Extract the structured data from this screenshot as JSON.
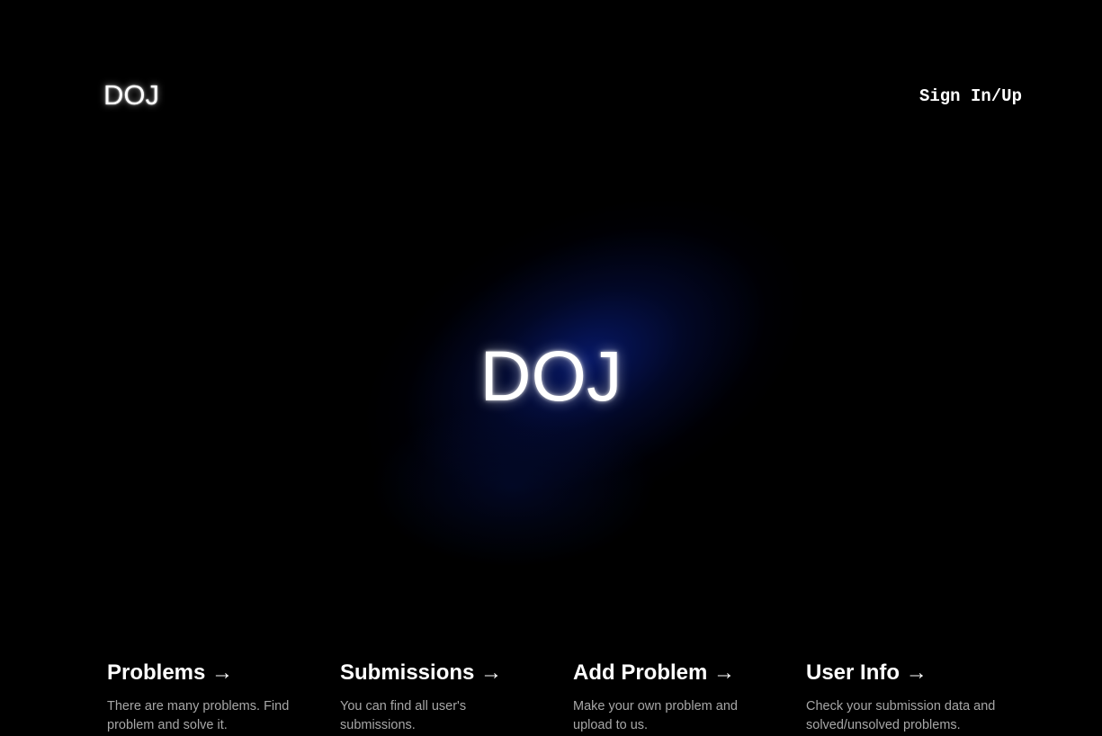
{
  "header": {
    "logo": "DOJ",
    "signin_label": "Sign In/Up"
  },
  "hero": {
    "title": "DOJ"
  },
  "cards": [
    {
      "title": "Problems",
      "arrow": "→",
      "description": "There are many problems. Find problem and solve it."
    },
    {
      "title": "Submissions",
      "arrow": "→",
      "description": "You can find all user's submissions."
    },
    {
      "title": "Add Problem",
      "arrow": "→",
      "description": "Make your own problem and upload to us."
    },
    {
      "title": "User Info",
      "arrow": "→",
      "description": "Check your submission data and solved/unsolved problems."
    }
  ],
  "colors": {
    "background": "#000000",
    "glow": "#081c78",
    "text": "#ffffff",
    "muted_text": "#a7a7a7"
  }
}
